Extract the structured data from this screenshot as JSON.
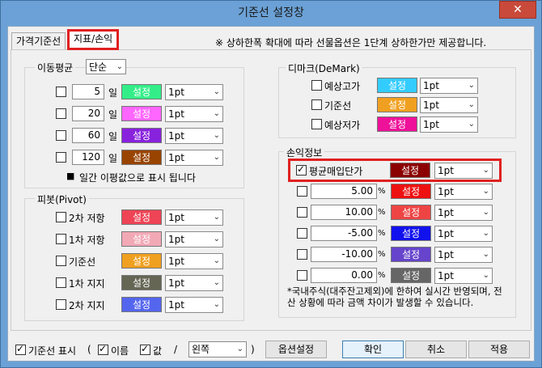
{
  "window": {
    "title": "기준선 설정창",
    "close_glyph": "✕"
  },
  "tabs": [
    {
      "label": "가격기준선"
    },
    {
      "label": "지표/손익"
    }
  ],
  "notice": "※ 상하한폭 확대에 따라 선물옵션은 1단계 상하한가만 제공합니다.",
  "ma": {
    "title": "이동평균",
    "type_value": "단순",
    "unit": "일",
    "rows": [
      {
        "checked": false,
        "period": "5",
        "btn": "설정",
        "color": "#33ee88",
        "width": "1pt"
      },
      {
        "checked": false,
        "period": "20",
        "btn": "설정",
        "color": "#ff66ff",
        "width": "1pt"
      },
      {
        "checked": false,
        "period": "60",
        "btn": "설정",
        "color": "#8822dd",
        "width": "1pt"
      },
      {
        "checked": false,
        "period": "120",
        "btn": "설정",
        "color": "#994400",
        "width": "1pt"
      }
    ],
    "footnote_bullet": "■",
    "footnote": "일간 이평값으로 표시 됩니다"
  },
  "pivot": {
    "title": "피봇(Pivot)",
    "rows": [
      {
        "checked": false,
        "label": "2차 저항",
        "btn": "설정",
        "color": "#ee4455",
        "width": "1pt"
      },
      {
        "checked": false,
        "label": "1차 저항",
        "btn": "설정",
        "color": "#f2a9b6",
        "width": "1pt"
      },
      {
        "checked": false,
        "label": "기준선",
        "btn": "설정",
        "color": "#f0a020",
        "width": "1pt"
      },
      {
        "checked": false,
        "label": "1차 지지",
        "btn": "설정",
        "color": "#666655",
        "width": "1pt"
      },
      {
        "checked": false,
        "label": "2차 지지",
        "btn": "설정",
        "color": "#5566ee",
        "width": "1pt"
      }
    ]
  },
  "demark": {
    "title": "디마크(DeMark)",
    "rows": [
      {
        "checked": false,
        "label": "예상고가",
        "btn": "설정",
        "color": "#33ccff",
        "width": "1pt"
      },
      {
        "checked": false,
        "label": "기준선",
        "btn": "설정",
        "color": "#f0a020",
        "width": "1pt"
      },
      {
        "checked": false,
        "label": "예상저가",
        "btn": "설정",
        "color": "#ee1199",
        "width": "1pt"
      }
    ]
  },
  "pnl": {
    "title": "손익정보",
    "avg": {
      "checked": true,
      "label": "평균매입단가",
      "btn": "설정",
      "color": "#8b0000",
      "width": "1pt"
    },
    "unit": "%",
    "rows": [
      {
        "checked": false,
        "value": "5.00",
        "btn": "설정",
        "color": "#ee1111",
        "width": "1pt"
      },
      {
        "checked": false,
        "value": "10.00",
        "btn": "설정",
        "color": "#ee4444",
        "width": "1pt"
      },
      {
        "checked": false,
        "value": "-5.00",
        "btn": "설정",
        "color": "#1111ee",
        "width": "1pt"
      },
      {
        "checked": false,
        "value": "-10.00",
        "btn": "설정",
        "color": "#6644cc",
        "width": "1pt"
      },
      {
        "checked": false,
        "value": "0.00",
        "btn": "설정",
        "color": "#666666",
        "width": "1pt"
      }
    ],
    "note": "*국내주식(대주잔고제외)에 한하여 실시간 반영되며, 전산 상황에 따라 금액 차이가 발생할 수 있습니다."
  },
  "footer": {
    "show_label": "기준선 표시",
    "paren_open": "(",
    "name_label": "이름",
    "value_label": "값",
    "slash": "/",
    "position_value": "왼쪽",
    "paren_close": ")",
    "option_btn": "옵션설정",
    "ok": "확인",
    "cancel": "취소",
    "apply": "적용"
  }
}
